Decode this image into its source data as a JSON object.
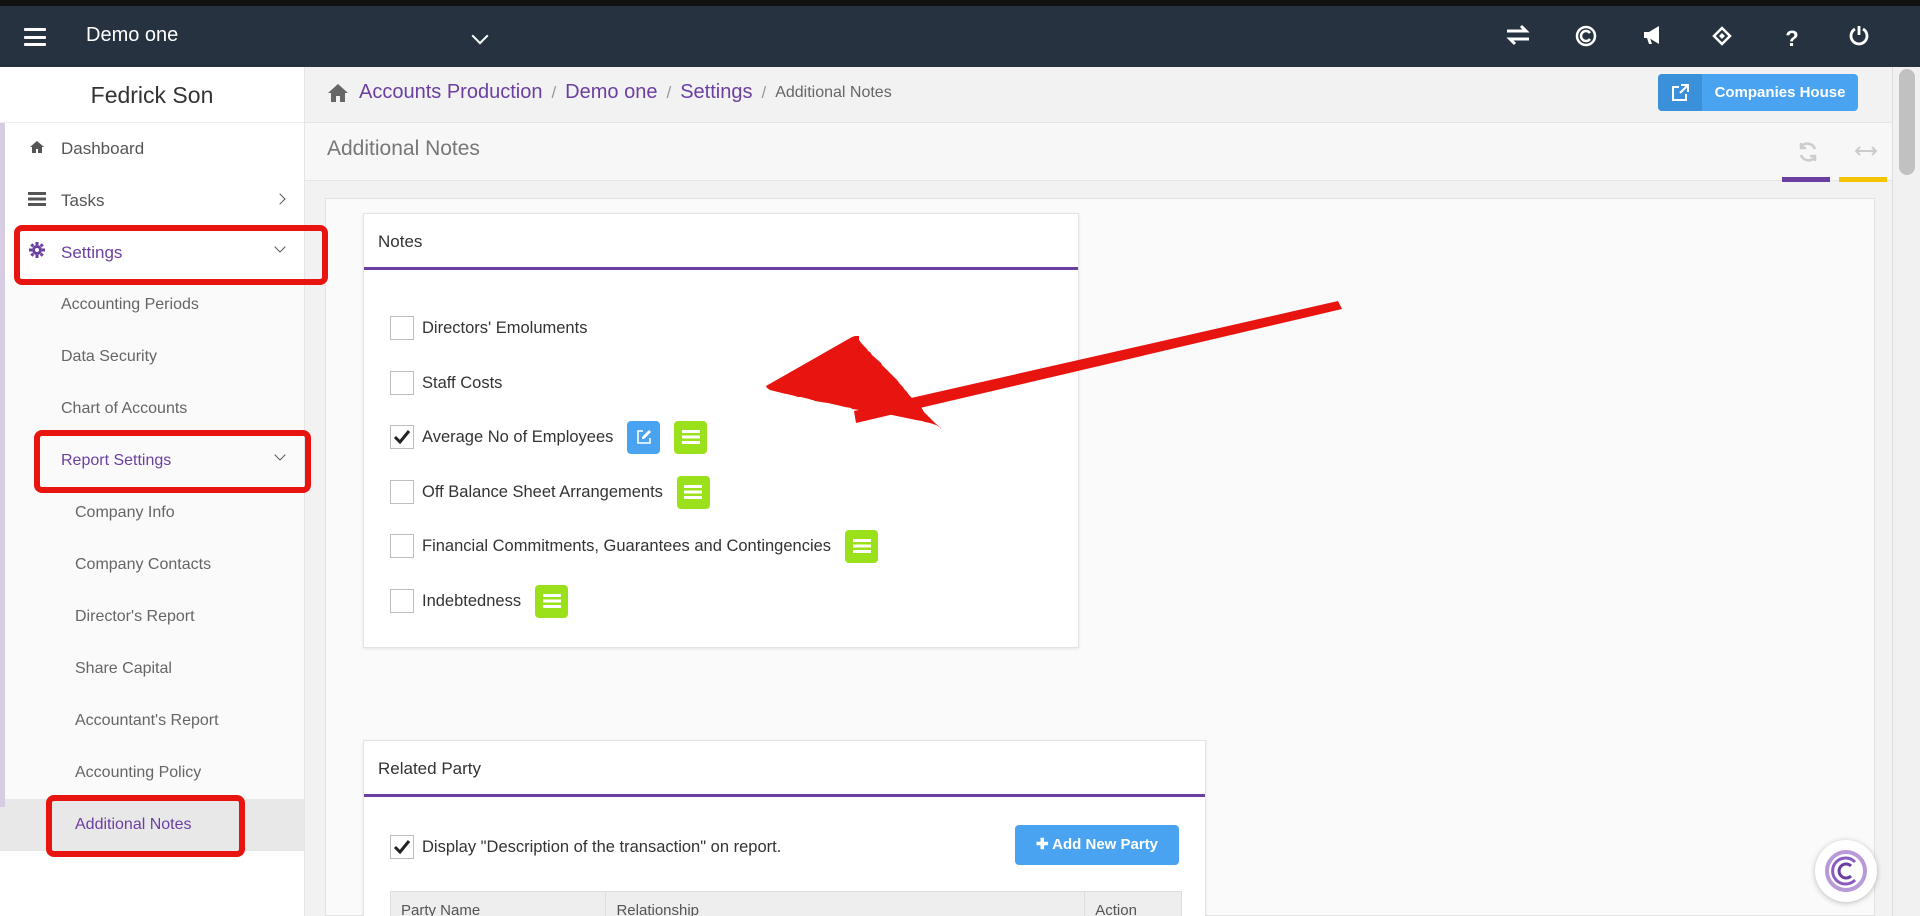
{
  "topbar": {
    "company": "Demo one",
    "icons": [
      "swap-icon",
      "copyright-icon",
      "megaphone-icon",
      "ticket-icon",
      "help-icon",
      "power-icon"
    ],
    "help_glyph": "?"
  },
  "sidebar": {
    "user_name": "Fedrick Son",
    "items": [
      {
        "label": "Dashboard",
        "icon": "home-icon"
      },
      {
        "label": "Tasks",
        "icon": "tasks-icon"
      },
      {
        "label": "Settings",
        "icon": "gear-icon"
      }
    ],
    "settings_sub": [
      {
        "label": "Accounting Periods"
      },
      {
        "label": "Data Security"
      },
      {
        "label": "Chart of Accounts"
      },
      {
        "label": "Report Settings"
      }
    ],
    "report_sub": [
      {
        "label": "Company Info"
      },
      {
        "label": "Company Contacts"
      },
      {
        "label": "Director's Report"
      },
      {
        "label": "Share Capital"
      },
      {
        "label": "Accountant's Report"
      },
      {
        "label": "Accounting Policy"
      },
      {
        "label": "Additional Notes"
      }
    ]
  },
  "breadcrumb": {
    "items": [
      "Accounts Production",
      "Demo one",
      "Settings"
    ],
    "current": "Additional Notes",
    "separator": "/"
  },
  "header_button": {
    "label": "Companies House"
  },
  "page": {
    "title": "Additional Notes"
  },
  "notes_panel": {
    "title": "Notes",
    "rows": [
      {
        "label": "Directors' Emoluments",
        "checked": false,
        "buttons": []
      },
      {
        "label": "Staff Costs",
        "checked": false,
        "buttons": []
      },
      {
        "label": "Average No of Employees",
        "checked": true,
        "buttons": [
          "edit-icon",
          "list-icon"
        ]
      },
      {
        "label": "Off Balance Sheet Arrangements",
        "checked": false,
        "buttons": [
          "list-icon"
        ]
      },
      {
        "label": "Financial Commitments, Guarantees and Contingencies",
        "checked": false,
        "buttons": [
          "list-icon"
        ]
      },
      {
        "label": "Indebtedness",
        "checked": false,
        "buttons": [
          "list-icon"
        ]
      }
    ]
  },
  "related_party": {
    "title": "Related Party",
    "display_option": "Display \"Description of the transaction\" on report.",
    "display_checked": true,
    "add_button": "Add New Party",
    "columns": [
      "Party Name",
      "Relationship",
      "Action"
    ]
  },
  "colors": {
    "topbar": "#263240",
    "accent": "#6b3fa0",
    "blue": "#4aa3f0",
    "green": "#9be11b",
    "annotation_red": "#e8140f",
    "yellow": "#f5c400"
  }
}
